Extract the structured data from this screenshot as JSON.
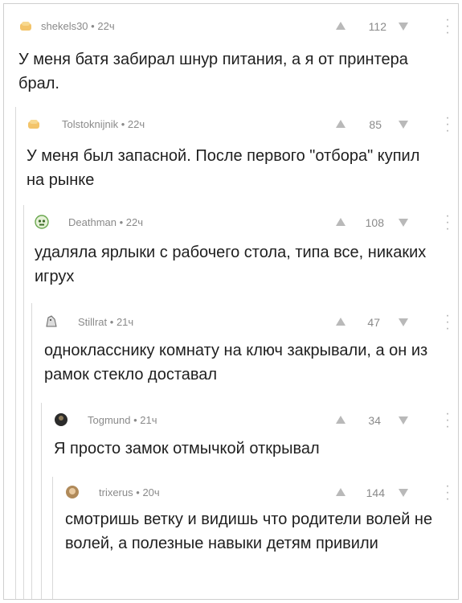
{
  "comments": [
    {
      "author": "shekels30",
      "time": "22ч",
      "score": "112",
      "avatar": "bread-avatar-icon",
      "text": "У меня батя забирал шнур питания, а я от принтера брал."
    },
    {
      "author": "Tolstoknijnik",
      "time": "22ч",
      "score": "85",
      "avatar": "bread-avatar-icon",
      "text": "У меня был запасной. После первого \"отбора\" купил на рынке"
    },
    {
      "author": "Deathman",
      "time": "22ч",
      "score": "108",
      "avatar": "skull-avatar-icon",
      "text": "удаляла ярлыки с рабочего стола, типа все, никаких игрух"
    },
    {
      "author": "Stillrat",
      "time": "21ч",
      "score": "47",
      "avatar": "rat-avatar-icon",
      "text": "однокласснику комнату на ключ закрывали, а он из рамок стекло доставал"
    },
    {
      "author": "Togmund",
      "time": "21ч",
      "score": "34",
      "avatar": "dark-avatar-icon",
      "text": "Я просто замок отмычкой открывал"
    },
    {
      "author": "trixerus",
      "time": "20ч",
      "score": "144",
      "avatar": "face-avatar-icon",
      "text": "смотришь ветку и видишь что родители волей не волей, а полезные навыки детям привили"
    }
  ],
  "separator": "•",
  "colors": {
    "meta": "#8a8a8a",
    "text": "#1f1f1f",
    "thread_line": "#d9d9d9",
    "vote_arrow": "#b9b9b9"
  }
}
